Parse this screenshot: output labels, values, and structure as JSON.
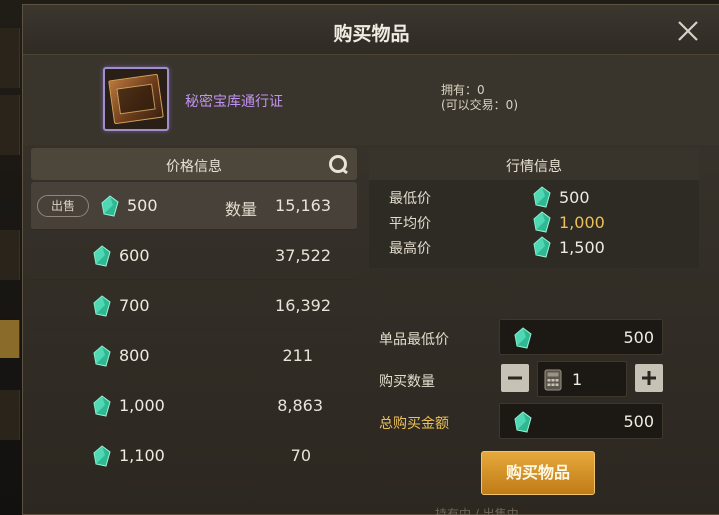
{
  "title": "购买物品",
  "item": {
    "name": "秘密宝库通行证",
    "owned": "拥有：0",
    "tradable": "(可以交易：0)"
  },
  "price_panel": {
    "header": "价格信息",
    "sell_tag": "出售",
    "qty_label": "数量",
    "rows": [
      {
        "price": "500",
        "qty": "15,163"
      },
      {
        "price": "600",
        "qty": "37,522"
      },
      {
        "price": "700",
        "qty": "16,392"
      },
      {
        "price": "800",
        "qty": "211"
      },
      {
        "price": "1,000",
        "qty": "8,863"
      },
      {
        "price": "1,100",
        "qty": "70"
      }
    ]
  },
  "market": {
    "header": "行情信息",
    "min_label": "最低价",
    "min_value": "500",
    "avg_label": "平均价",
    "avg_value": "1,000",
    "max_label": "最高价",
    "max_value": "1,500"
  },
  "purchase": {
    "unit_price_label": "单品最低价",
    "unit_price": "500",
    "qty_label": "购买数量",
    "qty": "1",
    "total_label": "总购买金额",
    "total": "500",
    "buy_button": "购买物品"
  },
  "footer": "持有中 / 出售中",
  "colors": {
    "accent": "#ecc15a",
    "button": "#d1901f",
    "item_name": "#c193f0",
    "gem": "#34c9a0"
  },
  "icons": {
    "close": "close-icon",
    "refresh": "refresh-icon",
    "gem": "gem-icon",
    "calculator": "calculator-icon"
  }
}
